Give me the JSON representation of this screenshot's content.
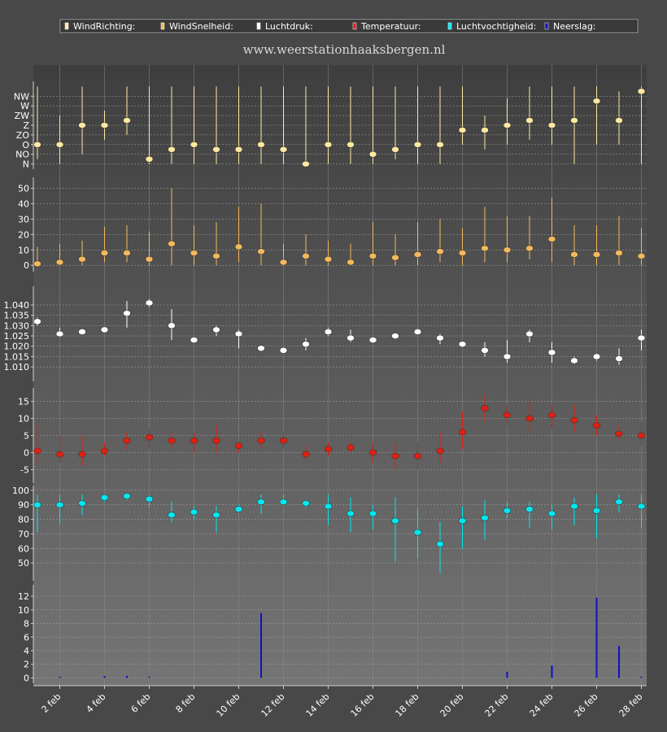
{
  "site_url": "www.weerstationhaaksbergen.nl",
  "legend": [
    {
      "label": "WindRichting:",
      "color": "#ffe9a0"
    },
    {
      "label": "WindSnelheid:",
      "color": "#f5b85c"
    },
    {
      "label": "Luchtdruk:",
      "color": "#ffffff"
    },
    {
      "label": "Temperatuur:",
      "color": "#e02010"
    },
    {
      "label": "Luchtvochtigheid:",
      "color": "#00e8f0"
    },
    {
      "label": "Neerslag:",
      "color": "#1010c0"
    }
  ],
  "chart_data": {
    "type": "multi-panel",
    "days": [
      1,
      2,
      3,
      4,
      5,
      6,
      7,
      8,
      9,
      10,
      11,
      12,
      13,
      14,
      15,
      16,
      17,
      18,
      19,
      20,
      21,
      22,
      23,
      24,
      25,
      26,
      27,
      28
    ],
    "x_tick_labels": [
      {
        "day": 2,
        "label": "2 feb"
      },
      {
        "day": 4,
        "label": "4 feb"
      },
      {
        "day": 6,
        "label": "6 feb"
      },
      {
        "day": 8,
        "label": "8 feb"
      },
      {
        "day": 10,
        "label": "10 feb"
      },
      {
        "day": 12,
        "label": "12 feb"
      },
      {
        "day": 14,
        "label": "14 feb"
      },
      {
        "day": 16,
        "label": "16 feb"
      },
      {
        "day": 18,
        "label": "18 feb"
      },
      {
        "day": 20,
        "label": "20 feb"
      },
      {
        "day": 22,
        "label": "22 feb"
      },
      {
        "day": 24,
        "label": "24 feb"
      },
      {
        "day": 26,
        "label": "26 feb"
      },
      {
        "day": 28,
        "label": "28 feb"
      }
    ],
    "panels": [
      {
        "id": "windrichting",
        "series": "WindRichting:",
        "color": "#ffe9a0",
        "kind": "range_dot",
        "categorical": true,
        "tick_labels": [
          "N",
          "NO",
          "O",
          "ZO",
          "Z",
          "ZW",
          "W",
          "NW"
        ],
        "ylim": [
          -0.2,
          8.2
        ],
        "mean": [
          2,
          2,
          4,
          4,
          4.5,
          0.5,
          1.5,
          2,
          1.5,
          1.5,
          2,
          1.5,
          0,
          2,
          2,
          1,
          1.5,
          2,
          2,
          3.5,
          3.5,
          4,
          4.5,
          4,
          4.5,
          6.5,
          4.5,
          7.5
        ],
        "low": [
          0.5,
          0,
          1,
          2.5,
          3,
          0,
          0,
          0,
          0,
          0,
          0,
          0,
          0,
          0,
          0,
          0,
          0.5,
          0,
          0,
          2,
          1.5,
          2,
          2.5,
          2,
          0,
          2,
          2,
          0
        ],
        "high": [
          8,
          5,
          8,
          5.5,
          8,
          8,
          8,
          8,
          8,
          8,
          8,
          8,
          8,
          8,
          8,
          8,
          8,
          8,
          8,
          8,
          5,
          6.8,
          8,
          8,
          8,
          8,
          7.5,
          8
        ]
      },
      {
        "id": "windsnelheid",
        "series": "WindSnelheid:",
        "color": "#f5b85c",
        "kind": "range_dot",
        "tick_labels": [
          "0",
          "10",
          "20",
          "30",
          "40",
          "50"
        ],
        "ticks": [
          0,
          10,
          20,
          30,
          40,
          50
        ],
        "ylim": [
          -2,
          55
        ],
        "mean": [
          1,
          2,
          4,
          8,
          8,
          4,
          14,
          8,
          6,
          12,
          9,
          2,
          6,
          4,
          2,
          6,
          5,
          7,
          9,
          8,
          11,
          10,
          11,
          17,
          7,
          7,
          8,
          6
        ],
        "low": [
          0,
          0,
          0,
          2,
          2,
          0,
          0,
          0,
          0,
          2,
          0,
          0,
          0,
          0,
          0,
          0,
          0,
          0,
          2,
          0,
          2,
          2,
          4,
          2,
          0,
          0,
          0,
          0
        ],
        "high": [
          12,
          14,
          16,
          25,
          26,
          22,
          50,
          26,
          28,
          38,
          40,
          14,
          20,
          16,
          14,
          28,
          20,
          28,
          30,
          24,
          38,
          32,
          32,
          44,
          26,
          26,
          32,
          24
        ]
      },
      {
        "id": "luchtdruk",
        "series": "Luchtdruk:",
        "color": "#ffffff",
        "kind": "range_dot",
        "tick_labels": [
          "1.010",
          "1.015",
          "1.020",
          "1.025",
          "1.030",
          "1.035",
          "1.040"
        ],
        "ticks": [
          1.01,
          1.015,
          1.02,
          1.025,
          1.03,
          1.035,
          1.04
        ],
        "ylim": [
          1.0045,
          1.0475
        ],
        "mean": [
          1.032,
          1.026,
          1.027,
          1.028,
          1.036,
          1.041,
          1.03,
          1.023,
          1.028,
          1.026,
          1.019,
          1.018,
          1.021,
          1.027,
          1.024,
          1.023,
          1.025,
          1.027,
          1.024,
          1.021,
          1.018,
          1.015,
          1.026,
          1.017,
          1.013,
          1.015,
          1.014,
          1.024
        ],
        "low": [
          1.03,
          1.025,
          1.026,
          1.027,
          1.029,
          1.039,
          1.023,
          1.022,
          1.025,
          1.019,
          1.018,
          1.017,
          1.018,
          1.025,
          1.022,
          1.022,
          1.024,
          1.026,
          1.021,
          1.02,
          1.015,
          1.012,
          1.022,
          1.012,
          1.012,
          1.013,
          1.011,
          1.018
        ],
        "high": [
          1.034,
          1.029,
          1.028,
          1.029,
          1.042,
          1.043,
          1.038,
          1.024,
          1.03,
          1.028,
          1.02,
          1.019,
          1.024,
          1.029,
          1.028,
          1.024,
          1.026,
          1.028,
          1.026,
          1.022,
          1.022,
          1.023,
          1.028,
          1.022,
          1.015,
          1.016,
          1.019,
          1.028
        ]
      },
      {
        "id": "temperatuur",
        "series": "Temperatuur:",
        "color": "#e02010",
        "kind": "range_dot",
        "tick_labels": [
          "-5",
          "0",
          "5",
          "10",
          "15"
        ],
        "ticks": [
          -5,
          0,
          5,
          10,
          15
        ],
        "ylim": [
          -8,
          18
        ],
        "mean": [
          0.5,
          -0.5,
          -0.5,
          0.5,
          3.5,
          4.5,
          3.5,
          3.5,
          3.5,
          2,
          3.5,
          3.5,
          -0.5,
          1,
          1.5,
          0,
          -1,
          -1,
          0.5,
          6,
          13,
          11,
          10,
          11,
          9.5,
          8,
          5.5,
          5
        ],
        "low": [
          -3,
          -3,
          -4,
          -1,
          1,
          1,
          1,
          0,
          0,
          0,
          1,
          1,
          -2,
          -1,
          0,
          -3,
          -5,
          -5,
          -3,
          1,
          9,
          8,
          6,
          7,
          6,
          5,
          4,
          2
        ],
        "high": [
          8,
          5,
          5,
          3,
          6,
          7,
          6,
          6,
          8,
          3,
          6,
          6,
          2,
          3,
          3,
          3,
          3,
          3,
          6,
          12,
          17,
          14,
          15,
          14,
          14,
          11,
          8,
          9
        ]
      },
      {
        "id": "luchtvochtigheid",
        "series": "Luchtvochtigheid:",
        "color": "#00e8f0",
        "kind": "range_dot",
        "tick_labels": [
          "50",
          "60",
          "70",
          "80",
          "90",
          "100"
        ],
        "ticks": [
          50,
          60,
          70,
          80,
          90,
          100
        ],
        "ylim": [
          40,
          101
        ],
        "mean": [
          90,
          90,
          91,
          95,
          96,
          94,
          83,
          85,
          83,
          87,
          92,
          92,
          91,
          89,
          84,
          84,
          79,
          71,
          63,
          79,
          81,
          86,
          87,
          84,
          89,
          86,
          92,
          89
        ],
        "low": [
          71,
          77,
          83,
          92,
          93,
          88,
          78,
          80,
          71,
          85,
          84,
          90,
          88,
          76,
          71,
          73,
          51,
          53,
          43,
          60,
          66,
          81,
          74,
          73,
          76,
          67,
          85,
          74
        ],
        "high": [
          97,
          97,
          97,
          97,
          97,
          97,
          92,
          89,
          89,
          90,
          97,
          97,
          93,
          97,
          95,
          90,
          95,
          88,
          78,
          89,
          93,
          92,
          92,
          90,
          95,
          97,
          97,
          97
        ]
      },
      {
        "id": "neerslag",
        "series": "Neerslag:",
        "color": "#1010c0",
        "kind": "bar",
        "tick_labels": [
          "0",
          "2",
          "4",
          "6",
          "8",
          "10",
          "12"
        ],
        "ticks": [
          0,
          2,
          4,
          6,
          8,
          10,
          12
        ],
        "ylim": [
          -0.3,
          13.2
        ],
        "values": [
          0,
          0.2,
          0,
          0.3,
          0.3,
          0.2,
          0,
          0,
          0,
          0,
          9.5,
          0,
          0,
          0,
          0,
          0,
          0,
          0,
          0,
          0,
          0,
          0.9,
          0,
          1.8,
          0,
          11.8,
          4.7,
          0.2
        ]
      }
    ]
  }
}
